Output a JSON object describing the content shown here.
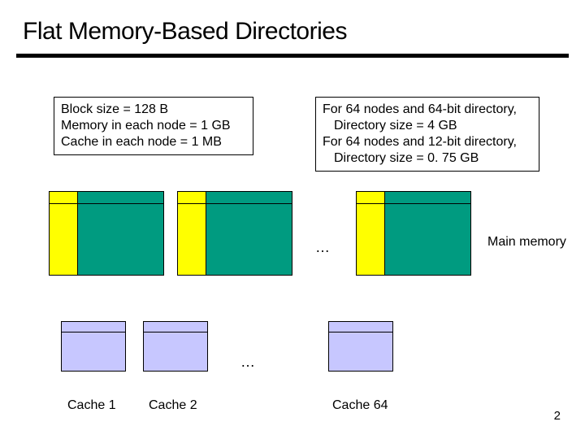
{
  "title": "Flat Memory-Based Directories",
  "box_left": {
    "l1": "Block size = 128 B",
    "l2": "Memory in each node = 1 GB",
    "l3": "Cache in each node = 1 MB"
  },
  "box_right": {
    "l1": "For 64 nodes and 64-bit directory,",
    "l2": "Directory size = 4 GB",
    "l3": "For 64 nodes and 12-bit directory,",
    "l4": "Directory size = 0. 75 GB"
  },
  "labels": {
    "main_memory": "Main memory",
    "cache1": "Cache 1",
    "cache2": "Cache 2",
    "cache64": "Cache 64",
    "ellipsis1": "…",
    "ellipsis2": "…"
  },
  "page_num": "2"
}
